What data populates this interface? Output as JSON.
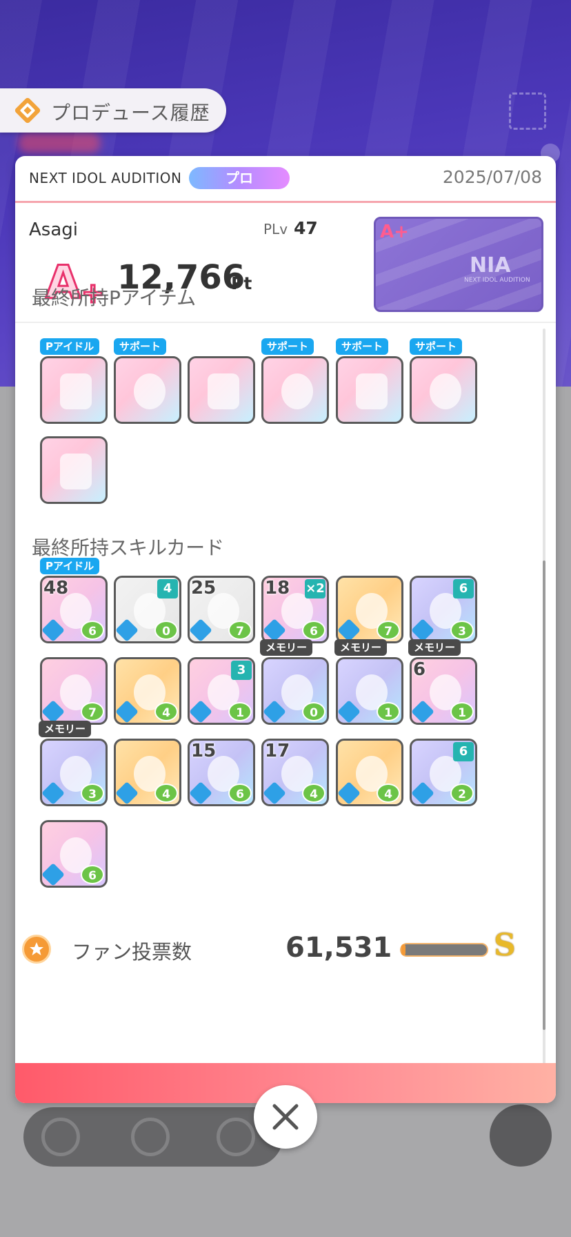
{
  "header": {
    "title": "プロデュース履歴"
  },
  "summary": {
    "audition_label": "NEXT IDOL AUDITION",
    "rank_pill": "プロ",
    "date": "2025/07/08",
    "player_name": "Asagi",
    "plv_label": "PLv",
    "plv_value": "47",
    "score": "12,766",
    "score_unit": "Pt",
    "rank": "A+",
    "card_logo": "NIA",
    "card_subtitle": "NEXT IDOL AUDITION",
    "card_rank": "A+"
  },
  "p_items": {
    "title": "最終所持Pアイテム",
    "items": [
      {
        "tag": "Pアイドル"
      },
      {
        "tag": "サポート"
      },
      {
        "tag": ""
      },
      {
        "tag": "サポート"
      },
      {
        "tag": "サポート"
      },
      {
        "tag": "サポート"
      },
      {
        "tag": ""
      }
    ]
  },
  "skill_cards": {
    "title": "最終所持スキルカード",
    "cards": [
      {
        "tag": "Pアイドル",
        "level": "48",
        "corner": "",
        "cost": "6"
      },
      {
        "tag": "",
        "level": "",
        "corner": "4",
        "cost": "0"
      },
      {
        "tag": "",
        "level": "25",
        "corner": "",
        "cost": "7"
      },
      {
        "tag": "",
        "level": "18",
        "corner": "×2",
        "cost": "6"
      },
      {
        "tag": "",
        "level": "",
        "corner": "",
        "cost": "7"
      },
      {
        "tag": "",
        "level": "",
        "corner": "6",
        "cost": "3"
      },
      {
        "tag": "",
        "level": "",
        "corner": "",
        "cost": "7"
      },
      {
        "tag": "",
        "level": "",
        "corner": "",
        "cost": "4"
      },
      {
        "tag": "",
        "level": "",
        "corner": "3",
        "cost": "1"
      },
      {
        "tag": "メモリー",
        "level": "",
        "corner": "",
        "cost": "0"
      },
      {
        "tag": "メモリー",
        "level": "",
        "corner": "",
        "cost": "1"
      },
      {
        "tag": "メモリー",
        "level": "6",
        "corner": "",
        "cost": "1"
      },
      {
        "tag": "メモリー",
        "level": "",
        "corner": "",
        "cost": "3"
      },
      {
        "tag": "",
        "level": "",
        "corner": "",
        "cost": "4"
      },
      {
        "tag": "",
        "level": "15",
        "corner": "",
        "cost": "6"
      },
      {
        "tag": "",
        "level": "17",
        "corner": "",
        "cost": "4"
      },
      {
        "tag": "",
        "level": "",
        "corner": "",
        "cost": "4"
      },
      {
        "tag": "",
        "level": "",
        "corner": "6",
        "cost": "2"
      },
      {
        "tag": "",
        "level": "",
        "corner": "",
        "cost": "6"
      }
    ]
  },
  "fan_votes": {
    "label": "ファン投票数",
    "value": "61,531",
    "progress": 0.05,
    "grade": "S"
  },
  "colors": {
    "accent_pink": "#ff5a6a",
    "tag_blue": "#1aa7f0",
    "memory_tag": "#4a4a4a",
    "cost_green": "#6cc447",
    "fan_orange": "#f59a36"
  },
  "icons": {
    "header": "produce-history-icon",
    "fan": "star-circle-icon",
    "close": "close-icon"
  }
}
